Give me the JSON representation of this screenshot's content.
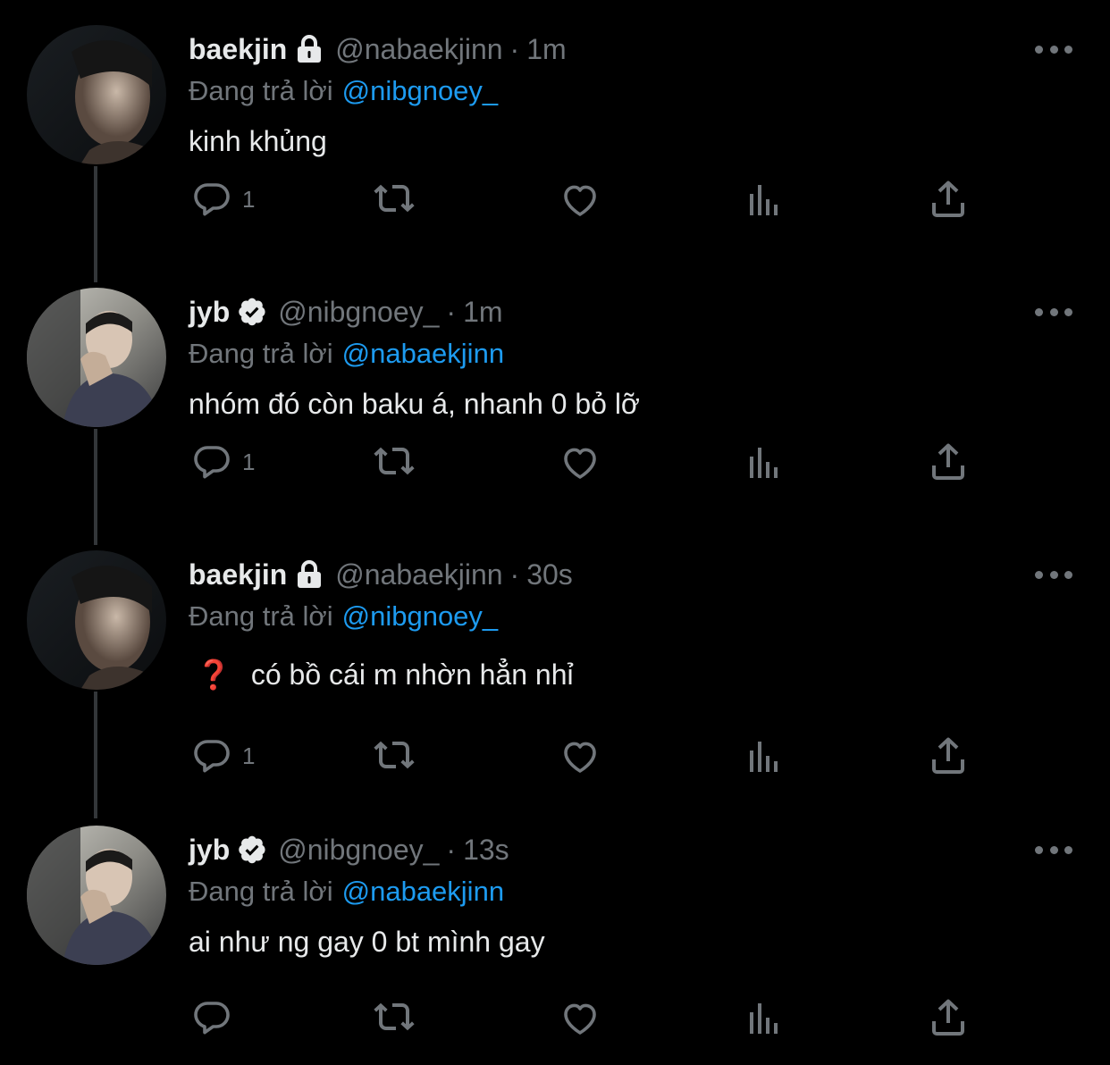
{
  "replying_prefix": "Đang trả lời",
  "colors": {
    "background": "#000000",
    "text": "#e7e9ea",
    "muted": "#71767b",
    "link": "#1d9bf0",
    "thread_line": "#333639"
  },
  "icons": {
    "reply": "reply-icon",
    "retweet": "retweet-icon",
    "like": "like-icon",
    "views": "views-icon",
    "share": "share-icon",
    "more": "more-icon",
    "lock": "lock-icon",
    "verified": "verified-icon"
  },
  "tweets": [
    {
      "name": "baekjin",
      "badge": "lock",
      "handle": "@nabaekjinn",
      "sep": "·",
      "time": "1m",
      "reply_to": "@nibgnoey_",
      "text": "kinh khủng",
      "reply_count": "1"
    },
    {
      "name": "jyb",
      "badge": "verified",
      "handle": "@nibgnoey_",
      "sep": "·",
      "time": "1m",
      "reply_to": "@nabaekjinn",
      "text": "nhóm đó còn baku á, nhanh 0 bỏ lỡ",
      "reply_count": "1"
    },
    {
      "name": "baekjin",
      "badge": "lock",
      "handle": "@nabaekjinn",
      "sep": "·",
      "time": "30s",
      "reply_to": "@nibgnoey_",
      "emoji": "❓",
      "text": "có bồ cái m nhờn hẳn nhỉ",
      "reply_count": "1"
    },
    {
      "name": "jyb",
      "badge": "verified",
      "handle": "@nibgnoey_",
      "sep": "·",
      "time": "13s",
      "reply_to": "@nabaekjinn",
      "text": "ai như ng gay 0 bt mình gay",
      "reply_count": ""
    }
  ]
}
